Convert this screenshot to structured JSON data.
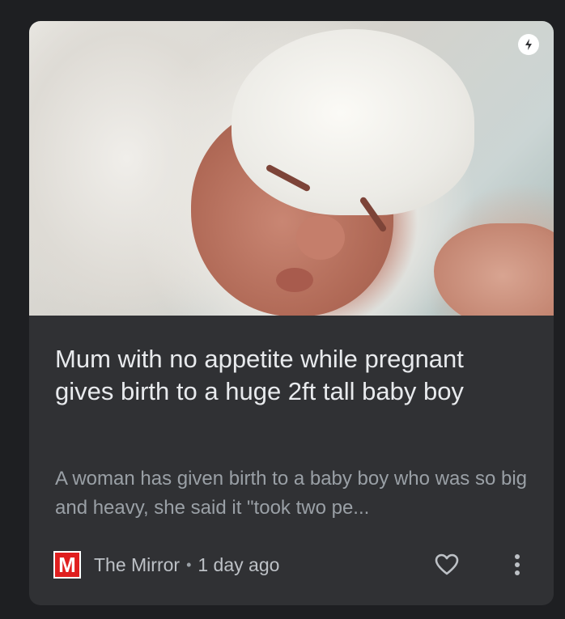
{
  "article": {
    "title": "Mum with no appetite while pregnant gives birth to a huge 2ft tall baby boy",
    "snippet": "A woman has given birth to a baby boy who was so big and heavy, she said it \"took two pe...",
    "source": "The Mirror",
    "separator": "•",
    "time": "1 day ago",
    "source_logo_letter": "M"
  },
  "icons": {
    "amp": "amp-lightning-icon",
    "like": "heart-outline-icon",
    "more": "more-vertical-icon"
  },
  "colors": {
    "background": "#1e1f22",
    "card": "#303134",
    "title": "#e8eaed",
    "snippet": "#9aa0a6",
    "mirror_red": "#e01e1e"
  }
}
